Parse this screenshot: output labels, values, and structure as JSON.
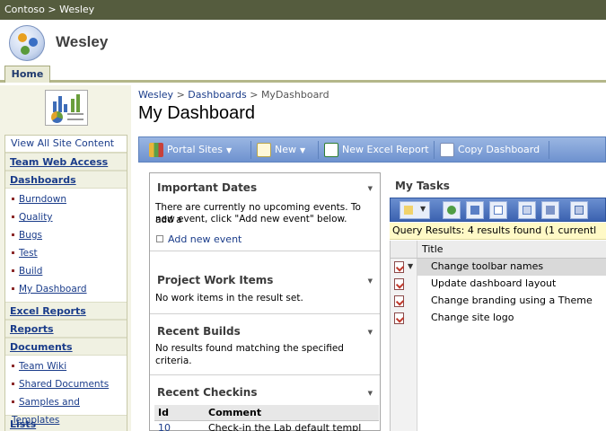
{
  "topbar": {
    "crumb": "Contoso > Wesley"
  },
  "header": {
    "site_title": "Wesley"
  },
  "tabs": [
    {
      "label": "Home"
    }
  ],
  "quicklaunch": {
    "view_all": "View All Site Content",
    "groups": [
      {
        "heading": "Team Web Access",
        "items": []
      },
      {
        "heading": "Dashboards",
        "items": [
          "Burndown",
          "Quality",
          "Bugs",
          "Test",
          "Build",
          "My Dashboard"
        ]
      },
      {
        "heading": "Excel Reports",
        "items": []
      },
      {
        "heading": "Reports",
        "items": []
      },
      {
        "heading": "Documents",
        "items": [
          "Team Wiki",
          "Shared Documents",
          "Samples and Templates"
        ]
      },
      {
        "heading": "Lists",
        "items": []
      }
    ]
  },
  "breadcrumb": {
    "site": "Wesley",
    "sep1": " > ",
    "section": "Dashboards",
    "sep2": " > ",
    "current": "MyDashboard"
  },
  "page_title": "My Dashboard",
  "toolbar": {
    "portal_sites": "Portal Sites",
    "new": "New",
    "new_excel_report": "New Excel Report",
    "copy_dashboard": "Copy Dashboard"
  },
  "important_dates": {
    "title": "Important Dates",
    "text_line1": "There are currently no upcoming events. To add a",
    "text_line2": "new event, click \"Add new event\" below.",
    "add_link": "Add new event"
  },
  "project_work_items": {
    "title": "Project Work Items",
    "text": "No work items in the result set."
  },
  "recent_builds": {
    "title": "Recent Builds",
    "text_line1": "No results found matching the specified",
    "text_line2": "criteria."
  },
  "recent_checkins": {
    "title": "Recent Checkins",
    "columns": [
      "Id",
      "Comment"
    ],
    "rows": [
      {
        "id": "10",
        "comment": "Check-in the Lab default templ"
      }
    ]
  },
  "my_tasks": {
    "title": "My Tasks",
    "query_results": "Query Results: 4 results found (1 currentl",
    "column_title": "Title",
    "rows": [
      "Change toolbar names",
      "Update dashboard layout",
      "Change branding using a Theme",
      "Change site logo"
    ]
  }
}
